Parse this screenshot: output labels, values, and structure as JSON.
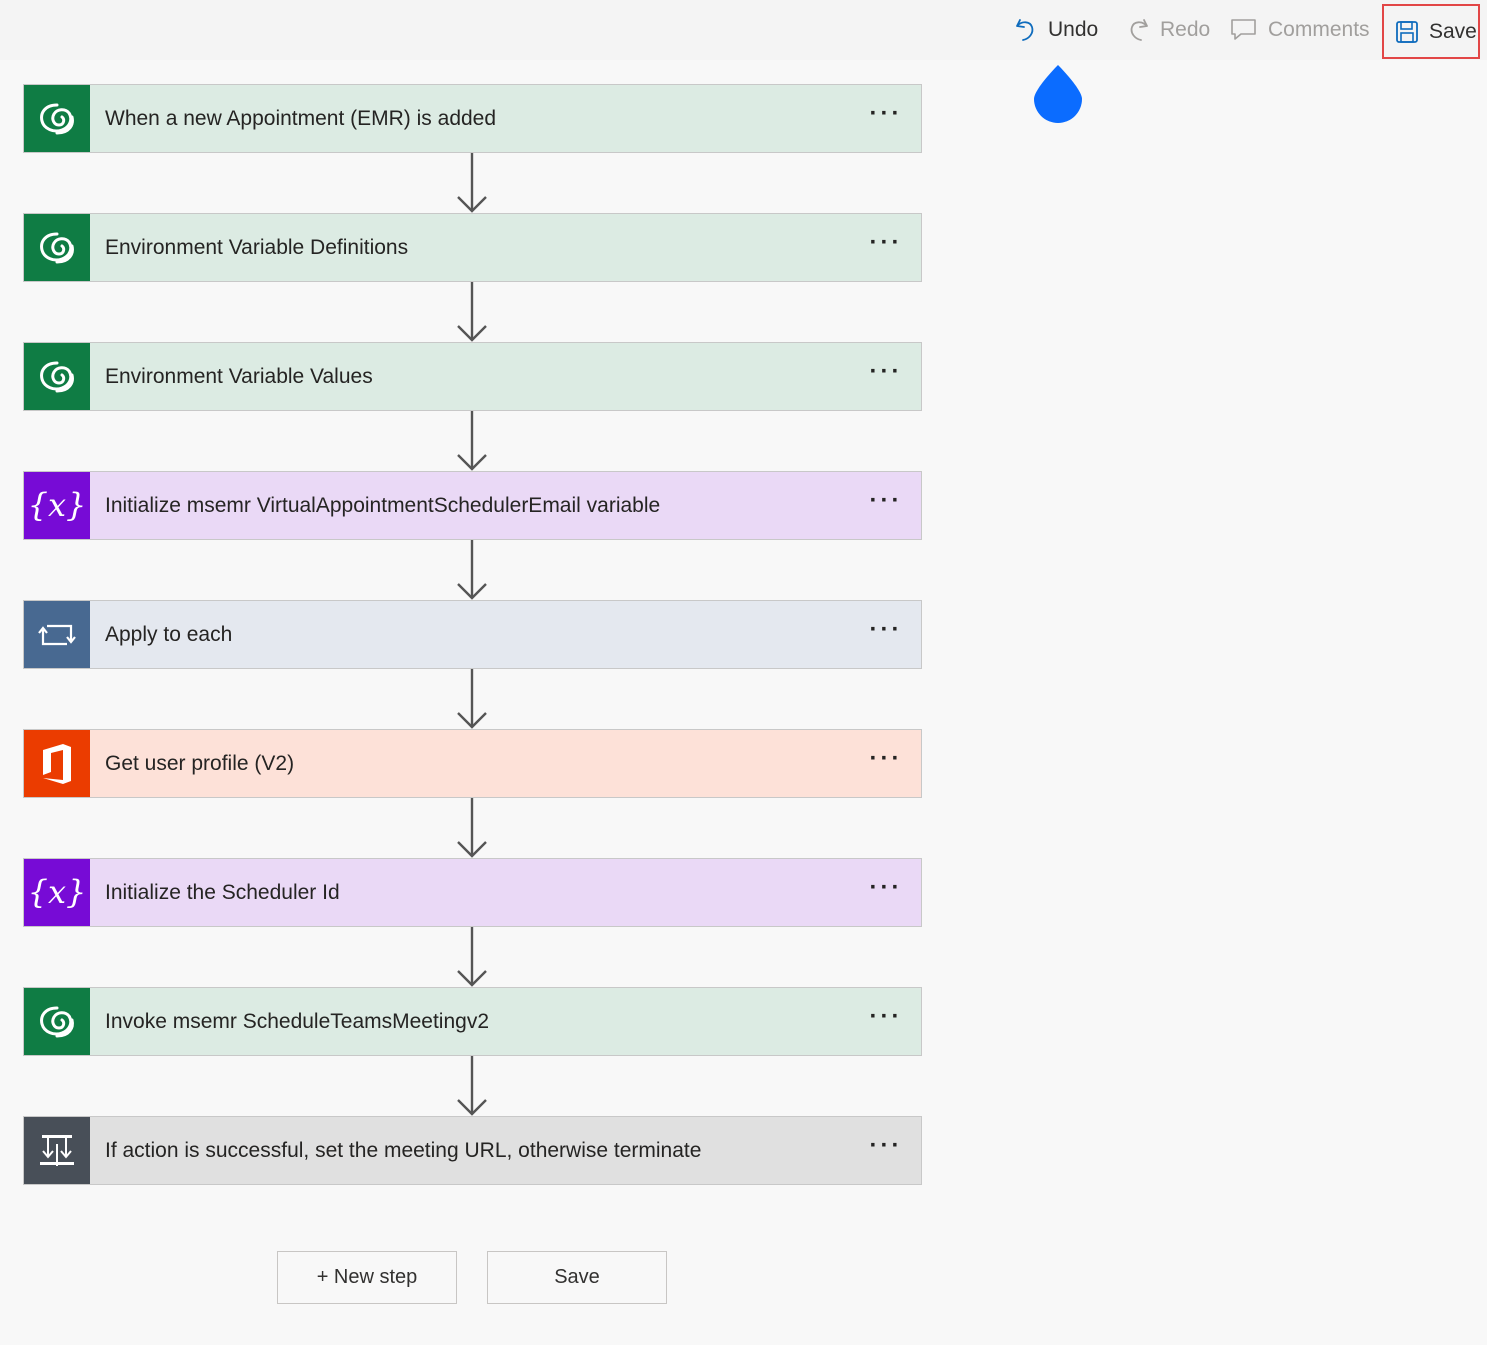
{
  "toolbar": {
    "undo_label": "Undo",
    "redo_label": "Redo",
    "comments_label": "Comments",
    "save_label": "Save"
  },
  "flow": {
    "steps": [
      {
        "title": "When a new Appointment (EMR) is added",
        "icon": "dataverse-icon",
        "color": "#0f7c44",
        "bg": "#dcebe3",
        "more": "···"
      },
      {
        "title": "Environment Variable Definitions",
        "icon": "dataverse-icon",
        "color": "#0f7c44",
        "bg": "#dcebe3",
        "more": "···"
      },
      {
        "title": "Environment Variable Values",
        "icon": "dataverse-icon",
        "color": "#0f7c44",
        "bg": "#dcebe3",
        "more": "···"
      },
      {
        "title": "Initialize msemr VirtualAppointmentSchedulerEmail variable",
        "icon": "variable-icon",
        "color": "#770bd6",
        "bg": "#ead9f6",
        "more": "···"
      },
      {
        "title": "Apply to each",
        "icon": "loop-icon",
        "color": "#486991",
        "bg": "#e4e8ef",
        "more": "···"
      },
      {
        "title": "Get user profile (V2)",
        "icon": "office-icon",
        "color": "#eb3c00",
        "bg": "#fde1d8",
        "more": "···"
      },
      {
        "title": "Initialize the Scheduler Id",
        "icon": "variable-icon",
        "color": "#770bd6",
        "bg": "#ead9f6",
        "more": "···"
      },
      {
        "title": "Invoke msemr ScheduleTeamsMeetingv2",
        "icon": "dataverse-icon",
        "color": "#0f7c44",
        "bg": "#dcebe3",
        "more": "···"
      },
      {
        "title": "If action is successful, set the meeting URL, otherwise terminate",
        "icon": "condition-icon",
        "color": "#484f58",
        "bg": "#e0e0e0",
        "more": "···"
      }
    ]
  },
  "actions": {
    "new_step_label": "+ New step",
    "save_label": "Save"
  },
  "colors": {
    "accent": "#0b6cff",
    "highlight_border": "#e24646"
  }
}
